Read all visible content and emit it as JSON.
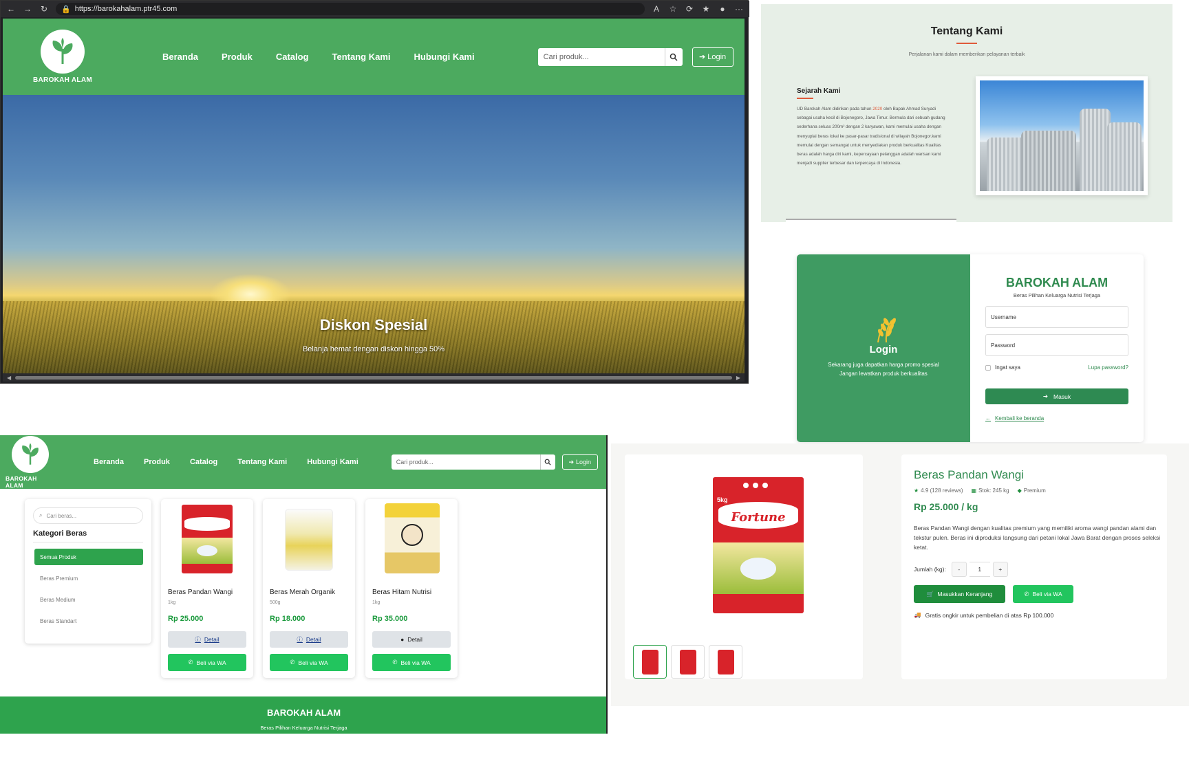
{
  "browser": {
    "url": "https://barokahalam.ptr45.com"
  },
  "site": {
    "brand": "BAROKAH ALAM",
    "nav": [
      "Beranda",
      "Produk",
      "Catalog",
      "Tentang Kami",
      "Hubungi Kami"
    ],
    "search_placeholder": "Cari produk...",
    "login_label": "Login",
    "brand_color": "#4caa5f"
  },
  "hero": {
    "title": "Diskon Spesial",
    "subtitle": "Belanja hemat dengan diskon hingga 50%"
  },
  "about": {
    "title": "Tentang Kami",
    "subtitle": "Perjalanan kami dalam memberikan pelayanan terbaik",
    "section_title": "Sejarah Kami",
    "body_before_year": "UD Barokah Alam didirikan pada tahun ",
    "year": "2020",
    "body_after_year": " oleh Bapak Ahmad Suryadi sebagai usaha kecil di Bojonegoro, Jawa Timur. Bermula dari sebuah gudang sederhana seluas 200m² dengan 2 karyawan, kami memulai usaha dengan menyuplai beras lokal ke pasar-pasar tradisional di wilayah Bojonegor.kami memulai dengan semangat untuk menyediakan produk berkualitas Kualitas beras adalah harga diri kami, kepercayaan pelanggan adalah warisan kami menjadi supplier terbesar dan terpercaya di Indonesia."
  },
  "login": {
    "left_title": "Login",
    "left_desc_1": "Sekarang juga dapatkan harga promo spesial",
    "left_desc_2": "Jangan lewatkan produk berkualitas",
    "brand": "BAROKAH ALAM",
    "tagline": "Beras Pilihan Keluarga Nutrisi Terjaga",
    "username_placeholder": "Username",
    "password_placeholder": "Password",
    "remember": "Ingat saya",
    "forgot": "Lupa password?",
    "submit": "Masuk",
    "back": "Kembali ke beranda"
  },
  "catalog": {
    "search_placeholder": "Cari beras...",
    "category_title": "Kategori Beras",
    "categories": [
      "Semua Produk",
      "Beras Premium",
      "Beras Medium",
      "Beras Standart"
    ],
    "products": [
      {
        "name": "Beras Pandan Wangi",
        "weight": "1kg",
        "price": "Rp 25.000",
        "detail": "Detail",
        "wa": "Beli via WA"
      },
      {
        "name": "Beras Merah Organik",
        "weight": "500g",
        "price": "Rp 18.000",
        "detail": "Detail",
        "wa": "Beli via WA"
      },
      {
        "name": "Beras Hitam Nutrisi",
        "weight": "1kg",
        "price": "Rp 35.000",
        "detail": "Detail",
        "wa": "Beli via WA"
      }
    ],
    "footer_title": "BAROKAH ALAM",
    "footer_sub": "Beras Pilihan Keluarga Nutrisi Terjaga"
  },
  "detail": {
    "name": "Beras Pandan Wangi",
    "rating": "4.9 (128 reviews)",
    "stock": "Stok: 245 kg",
    "tag": "Premium",
    "price": "Rp 25.000 / kg",
    "description": "Beras Pandan Wangi dengan kualitas premium yang memiliki aroma wangi pandan alami dan tekstur pulen. Beras ini diproduksi langsung dari petani lokal Jawa Barat dengan proses seleksi ketat.",
    "qty_label": "Jumlah (kg):",
    "qty_minus": "-",
    "qty_value": "1",
    "qty_plus": "+",
    "cart": "Masukkan Keranjang",
    "wa": "Beli via WA",
    "shipping": "Gratis ongkir untuk pembelian di atas Rp 100.000",
    "bag_brand": "Fortune",
    "bag_size": "5kg"
  }
}
